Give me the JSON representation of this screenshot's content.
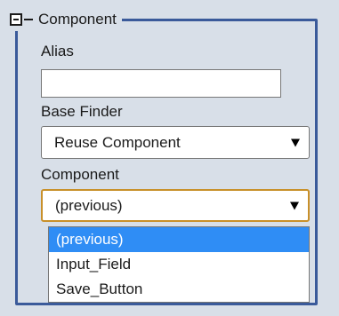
{
  "colors": {
    "panel_bg": "#d8dfe8",
    "fieldset_border": "#3a5a9a",
    "focus_border": "#c8902a",
    "selection_bg": "#2f8df5"
  },
  "fieldset": {
    "legend": "Component",
    "toggle_icon": "collapse-minus"
  },
  "alias": {
    "label": "Alias",
    "value": ""
  },
  "base_finder": {
    "label": "Base Finder",
    "selected": "Reuse Component"
  },
  "component": {
    "label": "Component",
    "selected": "(previous)",
    "options": [
      {
        "label": "(previous)",
        "highlighted": true
      },
      {
        "label": "Input_Field",
        "highlighted": false
      },
      {
        "label": "Save_Button",
        "highlighted": false
      }
    ]
  }
}
